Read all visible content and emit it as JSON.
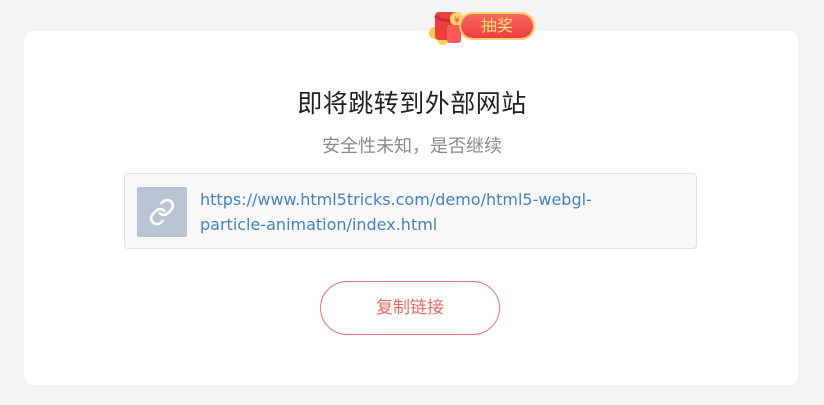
{
  "promo": {
    "label": "抽奖",
    "icon": "red-envelope-icon",
    "colors": {
      "background": "#ec3b3b",
      "text": "#ffe27a",
      "outline": "#ffd36e"
    }
  },
  "dialog": {
    "title": "即将跳转到外部网站",
    "subtitle": "安全性未知，是否继续",
    "link": {
      "icon": "link-icon",
      "url": "https://www.html5tricks.com/demo/html5-webgl-particle-animation/index.html"
    },
    "copy_button_label": "复制链接"
  },
  "colors": {
    "page_background": "#f3f3f3",
    "card_background": "#ffffff",
    "link_text": "#3f86bf",
    "accent": "#ea6d64",
    "link_icon_background": "#b8c4d6"
  }
}
